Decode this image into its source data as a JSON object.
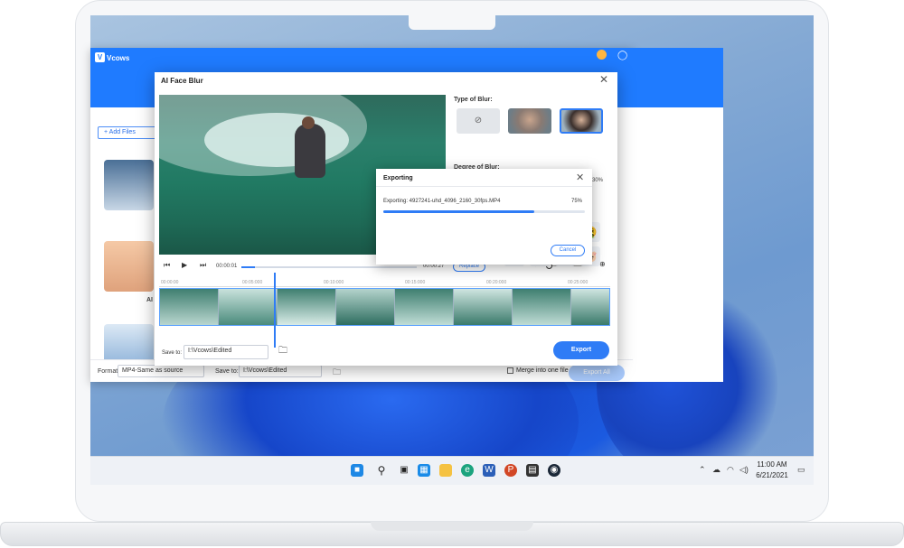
{
  "app": {
    "title": "Vcows",
    "add_files": "+ Add Files",
    "thumb_label": "AI",
    "format_label": "Format:",
    "format_value": "MP4-Same as source",
    "save_label": "Save to:",
    "save_value": "I:\\Vcows\\Edited",
    "merge_label": "Merge into one file",
    "export_all": "Export All"
  },
  "dialog": {
    "title": "AI Face Blur",
    "time_current": "00:00:01",
    "time_total": "00:00:27",
    "replace": "Replace",
    "ruler": [
      "00:00:00",
      "00:05:000",
      "00:10:000",
      "00:15:000",
      "00:20:000",
      "00:25:000"
    ],
    "save_label": "Save to:",
    "save_value": "I:\\Vcows\\Edited",
    "export": "Export",
    "progress": 0.075
  },
  "panel": {
    "type_title": "Type of Blur:",
    "degree_title": "Degree of Blur:",
    "degree_value": "30%",
    "degree": 0.3
  },
  "export_dialog": {
    "title": "Exporting",
    "text": "Exporting: 4927241-uhd_4096_2160_30fps.MP4",
    "percent": "75%",
    "progress": 0.75,
    "cancel": "Cancel"
  },
  "clock": {
    "time": "11:00 AM",
    "date": "6/21/2021"
  },
  "colors": {
    "accent": "#2f7cf6",
    "app_bar": "#1f7bff"
  }
}
